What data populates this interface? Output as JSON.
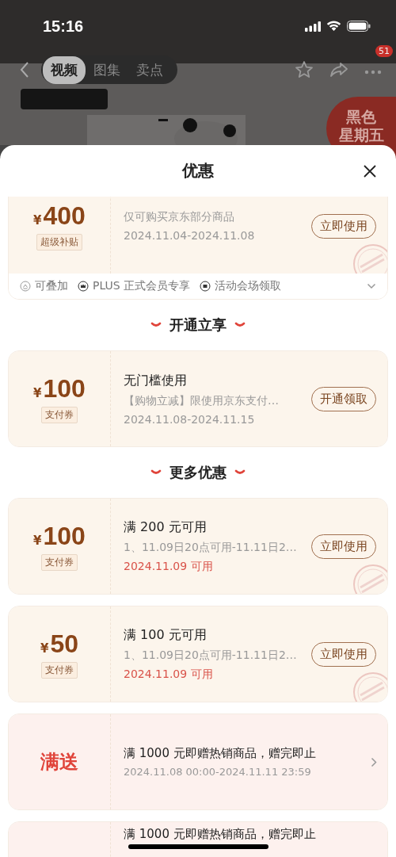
{
  "status_bar": {
    "time": "15:16"
  },
  "nav": {
    "tabs": [
      {
        "label": "视频",
        "selected": true
      },
      {
        "label": "图集",
        "selected": false
      },
      {
        "label": "卖点",
        "selected": false
      }
    ],
    "more_badge": "51",
    "promo_badge": [
      "黑色",
      "星期五"
    ],
    "hero": {
      "kind": "picture"
    }
  },
  "sheet": {
    "title": "优惠",
    "sections": [
      {
        "items": [
          {
            "kind": "coupon",
            "currency": "¥",
            "amount": "400",
            "tag": "超级补贴",
            "lines": [
              {
                "kind": "detail",
                "text": "仅可购买京东部分商品"
              },
              {
                "kind": "detail",
                "text": "2024.11.04-2024.11.08"
              }
            ],
            "button": "立即使用",
            "claimed": true,
            "features": [
              "可叠加",
              "PLUS 正式会员专享",
              "活动会场领取"
            ]
          }
        ]
      },
      {
        "heading": "开通立享",
        "items": [
          {
            "kind": "coupon",
            "currency": "¥",
            "amount": "100",
            "tag": "支付券",
            "lines": [
              {
                "kind": "title",
                "text": "无门槛使用"
              },
              {
                "kind": "detail",
                "text": "【购物立减】限使用京东支付…"
              },
              {
                "kind": "detail",
                "text": "2024.11.08-2024.11.15"
              }
            ],
            "button": "开通领取",
            "claimed": false
          }
        ]
      },
      {
        "heading": "更多优惠",
        "items": [
          {
            "kind": "coupon",
            "currency": "¥",
            "amount": "100",
            "tag": "支付券",
            "lines": [
              {
                "kind": "title",
                "text": "满 200 元可用"
              },
              {
                "kind": "detail",
                "text": "1、11.09日20点可用-11.11日2…"
              },
              {
                "kind": "notice",
                "text": "2024.11.09 可用"
              }
            ],
            "button": "立即使用",
            "claimed": true
          },
          {
            "kind": "coupon",
            "currency": "¥",
            "amount": "50",
            "tag": "支付券",
            "lines": [
              {
                "kind": "title",
                "text": "满 100 元可用"
              },
              {
                "kind": "detail",
                "text": "1、11.09日20点可用-11.11日2…"
              },
              {
                "kind": "notice",
                "text": "2024.11.09 可用"
              }
            ],
            "button": "立即使用",
            "claimed": true
          },
          {
            "kind": "gift",
            "label": "满送",
            "lines": [
              {
                "kind": "title",
                "text": "满 1000 元即赠热销商品，赠完即止"
              },
              {
                "kind": "detail",
                "text": "2024.11.08 00:00-2024.11.11 23:59"
              }
            ]
          },
          {
            "kind": "gift",
            "lines": [
              {
                "kind": "title",
                "text": "满 1000 元即赠热销商品，赠完即止"
              }
            ]
          }
        ]
      }
    ]
  }
}
